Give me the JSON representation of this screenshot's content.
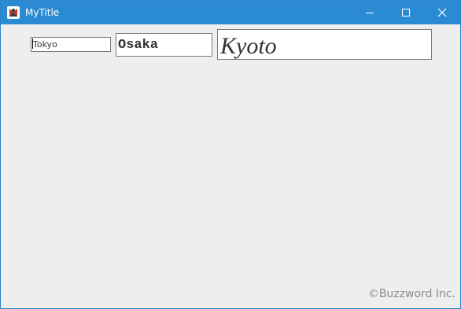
{
  "window": {
    "title": "MyTitle",
    "icon": "java-app-icon",
    "controls": {
      "minimize_icon": "minimize-icon",
      "maximize_icon": "maximize-icon",
      "close_icon": "close-icon"
    }
  },
  "fields": {
    "tokyo": {
      "value": "Tokyo"
    },
    "osaka": {
      "value": "Osaka"
    },
    "kyoto": {
      "value": "Kyoto"
    }
  },
  "footer": {
    "copyright": "©Buzzword Inc."
  },
  "colors": {
    "titlebar": "#2a8ad2",
    "window_bg": "#eeeeee",
    "field_border": "#7a7a7a"
  }
}
